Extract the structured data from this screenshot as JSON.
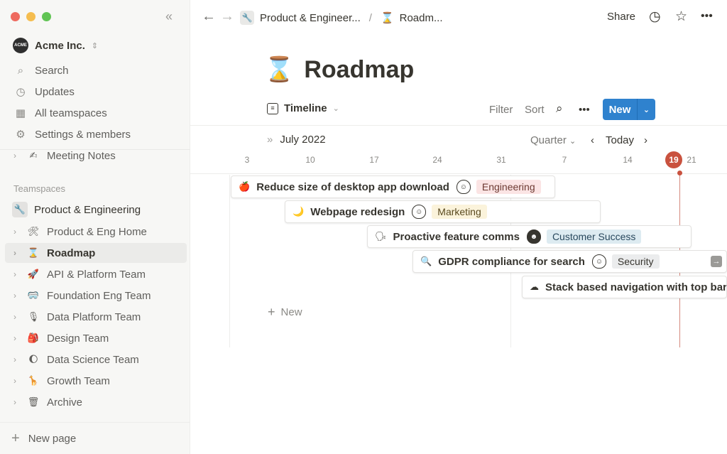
{
  "colors": {
    "accent": "#2f82ce",
    "today": "#c9523f",
    "close": "#ee6a5f",
    "min": "#f5bd4f",
    "max": "#61c454"
  },
  "sidebar": {
    "workspace": {
      "logo": "ACME",
      "name": "Acme Inc.",
      "caret": "⌃⌄"
    },
    "nav": [
      {
        "icon": "search-icon",
        "glyph": "⌕",
        "label": "Search"
      },
      {
        "icon": "clock-icon",
        "glyph": "◷",
        "label": "Updates"
      },
      {
        "icon": "teamspaces-icon",
        "glyph": "▦",
        "label": "All teamspaces"
      },
      {
        "icon": "gear-icon",
        "glyph": "⚙",
        "label": "Settings & members"
      }
    ],
    "meeting_notes": {
      "emoji": "✍",
      "label": "Meeting Notes"
    },
    "section_label": "Teamspaces",
    "teamspace": {
      "emoji": "🔧",
      "label": "Product & Engineering"
    },
    "pages": [
      {
        "emoji": "🛠",
        "label": "Product & Eng Home"
      },
      {
        "emoji": "⌛",
        "label": "Roadmap"
      },
      {
        "emoji": "🚀",
        "label": "API & Platform Team"
      },
      {
        "emoji": "🥽",
        "label": "Foundation Eng Team"
      },
      {
        "emoji": "🎙",
        "label": "Data Platform Team"
      },
      {
        "emoji": "🎒",
        "label": "Design Team"
      },
      {
        "emoji": "🌔",
        "label": "Data Science Team"
      },
      {
        "emoji": "🦒",
        "label": "Growth Team"
      },
      {
        "emoji": "🗑",
        "label": "Archive"
      }
    ],
    "new_page": "New page"
  },
  "topbar": {
    "breadcrumb": [
      {
        "emoji": "🔧",
        "label": "Product & Engineer..."
      },
      {
        "emoji": "⌛",
        "label": "Roadm..."
      }
    ],
    "separator": "/",
    "share": "Share"
  },
  "page": {
    "icon": "⌛",
    "title": "Roadmap"
  },
  "view": {
    "name": "Timeline",
    "filter": "Filter",
    "sort": "Sort",
    "more": "•••",
    "new": "New"
  },
  "timeline": {
    "month": "July 2022",
    "scale": "Quarter",
    "today": "Today",
    "today_date": "19",
    "days": [
      "3",
      "10",
      "17",
      "24",
      "31",
      "7",
      "14",
      "21"
    ],
    "tasks": [
      {
        "emoji": "🍎",
        "name": "Reduce size of desktop app download",
        "avatar": "☺",
        "tag": "Engineering",
        "tag_bg": "#fbe4e4",
        "tag_fg": "#6d3a32"
      },
      {
        "emoji": "🌙",
        "name": "Webpage redesign",
        "avatar": "☺",
        "tag": "Marketing",
        "tag_bg": "#fbf3db",
        "tag_fg": "#5a4a1f"
      },
      {
        "emoji": "🗣",
        "name": "Proactive feature comms",
        "avatar": "☻",
        "tag": "Customer Success",
        "tag_bg": "#ddebf1",
        "tag_fg": "#29485d"
      },
      {
        "emoji": "🔍",
        "name": "GDPR compliance for search",
        "avatar": "☺",
        "tag": "Security",
        "tag_bg": "#ebeced",
        "tag_fg": "#37352f"
      },
      {
        "emoji": "☁",
        "name": "Stack based navigation with top bar",
        "avatar": "",
        "tag": "",
        "tag_bg": "",
        "tag_fg": ""
      }
    ],
    "add_new": "New"
  }
}
